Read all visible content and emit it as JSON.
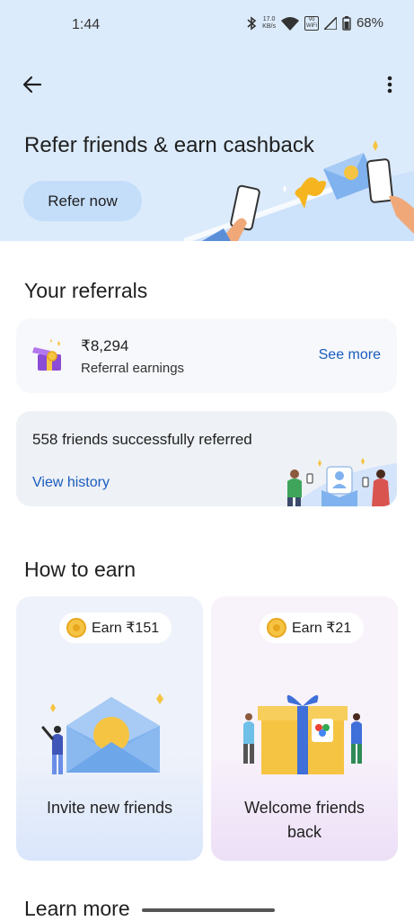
{
  "status_bar": {
    "time": "1:44",
    "net_speed_value": "17.0",
    "net_speed_unit": "KB/s",
    "vowifi_line1": "Vo",
    "vowifi_line2": "WiFi",
    "battery": "68%"
  },
  "header": {
    "title": "Refer friends & earn cashback",
    "refer_button": "Refer now"
  },
  "referrals": {
    "section_title": "Your referrals",
    "earnings_amount": "₹8,294",
    "earnings_label": "Referral earnings",
    "see_more": "See more",
    "friends_text": "558 friends successfully referred",
    "view_history": "View history"
  },
  "how_to_earn": {
    "section_title": "How to earn",
    "cards": [
      {
        "earn": "Earn ₹151",
        "label": "Invite new friends"
      },
      {
        "earn": "Earn ₹21",
        "label_line1": "Welcome friends",
        "label_line2": "back"
      }
    ]
  },
  "footer": {
    "learn_more": "Learn more"
  },
  "colors": {
    "hero_bg": "#dcebfb",
    "refer_button_bg": "#c4defa",
    "link": "#1a5cbf",
    "coin": "#f6c443"
  },
  "icons": [
    "bluetooth-icon",
    "wifi-icon",
    "signal-icon",
    "battery-icon",
    "back-arrow-icon",
    "more-vert-icon",
    "gift-icon",
    "coin-icon"
  ]
}
